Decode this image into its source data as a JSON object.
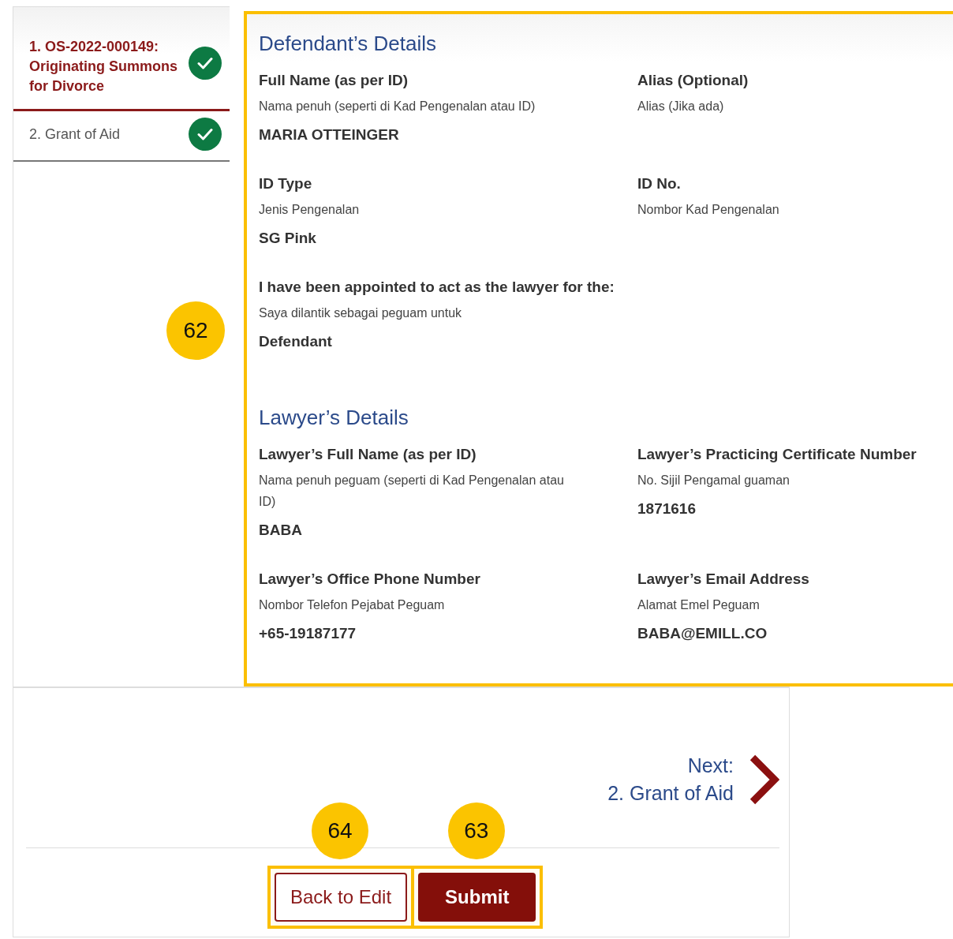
{
  "steps": [
    {
      "label": "1. OS-2022-000149: Originating Summons for Divorce",
      "selected": true,
      "completed": true
    },
    {
      "label": "2. Grant of Aid",
      "selected": false,
      "completed": true
    }
  ],
  "panel": {
    "highlighted": true,
    "callout": "62",
    "sections": [
      {
        "title": "Defendant’s Details",
        "fields": [
          {
            "label": "Full Name (as per ID)",
            "translation": "Nama penuh (seperti di Kad Pengenalan atau ID)",
            "value": "MARIA OTTEINGER"
          },
          {
            "label": "Alias (Optional)",
            "translation": "Alias (Jika ada)"
          },
          {
            "label": "ID Type",
            "translation": "Jenis Pengenalan",
            "value": "SG Pink"
          },
          {
            "label": "ID No.",
            "translation": "Nombor Kad Pengenalan"
          },
          {
            "label": "I have been appointed to act as the lawyer for the:",
            "translation": "Saya dilantik sebagai peguam untuk",
            "value": "Defendant"
          }
        ]
      },
      {
        "title": "Lawyer’s Details",
        "fields": [
          {
            "label": "Lawyer’s Full Name (as per ID)",
            "translation": "Nama penuh peguam (seperti di Kad Pengenalan atau ID)",
            "value": "BABA"
          },
          {
            "label": "Lawyer’s Practicing Certificate Number",
            "translation": "No. Sijil Pengamal guaman",
            "value": "1871616"
          },
          {
            "label": "Lawyer’s Office Phone Number",
            "translation": "Nombor Telefon Pejabat Peguam",
            "value": "+65-19187177"
          },
          {
            "label": "Lawyer’s Email Address",
            "translation": "Alamat Emel Peguam",
            "value": "BABA@EMILL.CO"
          }
        ]
      }
    ]
  },
  "next": {
    "caption": "Next:",
    "label": "2. Grant of Aid"
  },
  "buttons": [
    {
      "label": "Back to Edit",
      "kind": "secondary",
      "highlighted": true,
      "callout": "64"
    },
    {
      "label": "Submit",
      "kind": "primary",
      "highlighted": true,
      "callout": "63"
    }
  ]
}
